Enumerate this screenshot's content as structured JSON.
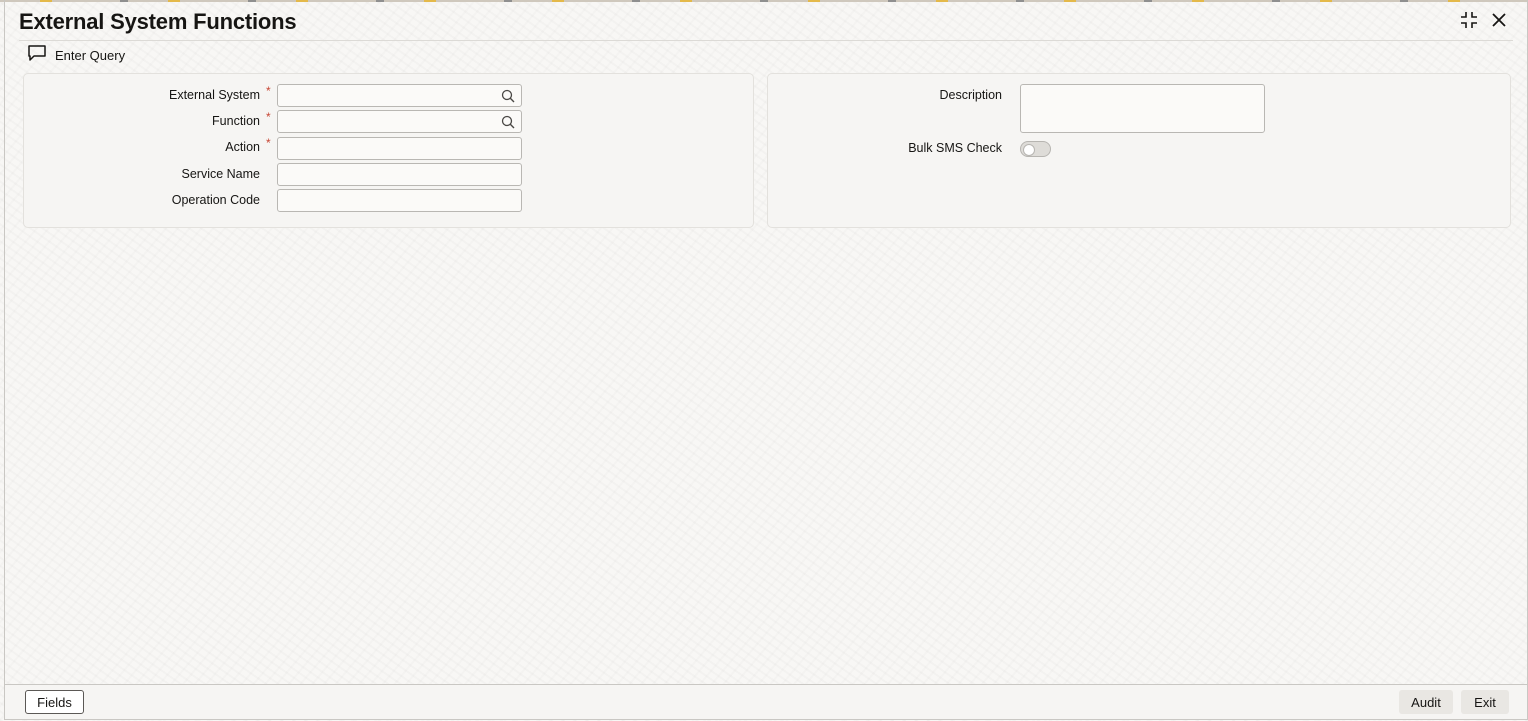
{
  "window": {
    "title": "External System Functions",
    "controls": [
      "collapse-icon",
      "close-icon"
    ]
  },
  "toolbar": {
    "enter_query_label": "Enter Query"
  },
  "form": {
    "external_system": {
      "label": "External System",
      "required": "*",
      "value": ""
    },
    "function": {
      "label": "Function",
      "required": "*",
      "value": ""
    },
    "action": {
      "label": "Action",
      "required": "*",
      "value": ""
    },
    "service_name": {
      "label": "Service Name",
      "value": ""
    },
    "operation_code": {
      "label": "Operation Code",
      "value": ""
    },
    "description": {
      "label": "Description",
      "value": ""
    },
    "bulk_sms_check": {
      "label": "Bulk SMS Check",
      "checked": false
    }
  },
  "footer": {
    "fields_label": "Fields",
    "audit_label": "Audit",
    "exit_label": "Exit"
  },
  "colors": {
    "required": "#c74634",
    "border": "#b9b7b3",
    "background": "#f8f7f5"
  }
}
